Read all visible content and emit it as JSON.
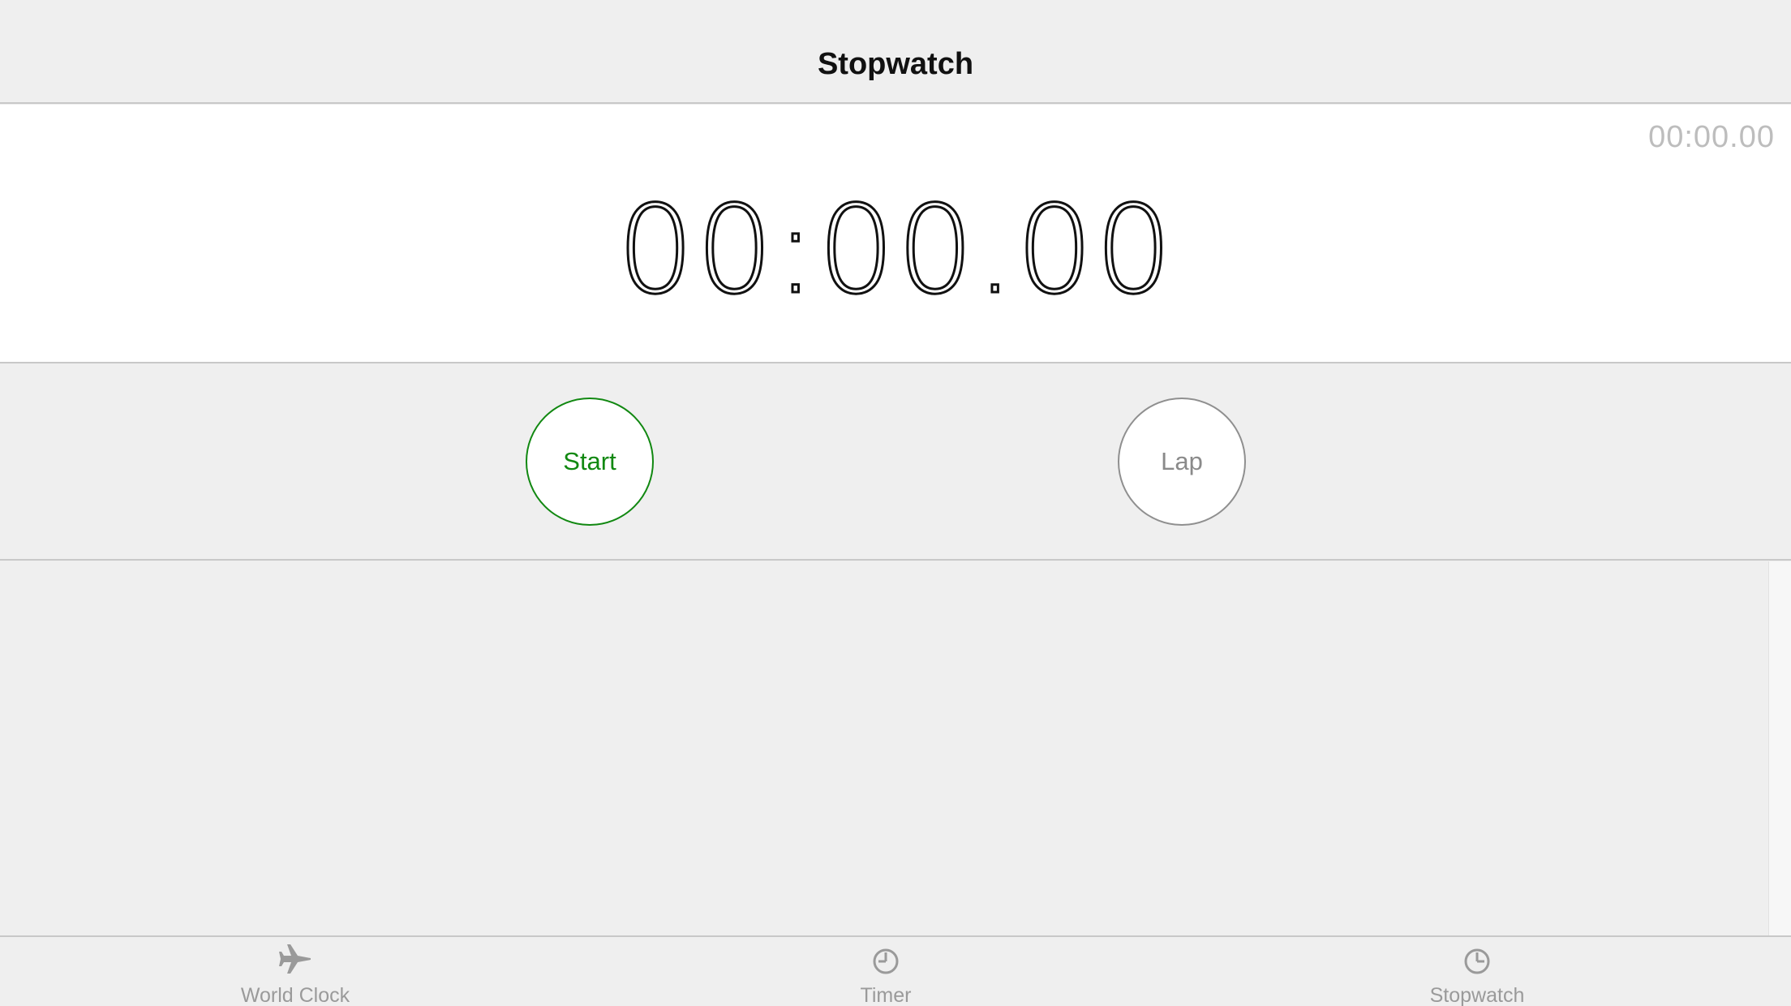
{
  "nav": {
    "title": "Stopwatch"
  },
  "timer": {
    "lap_time": "00:00.00",
    "main_time": "00:00.00"
  },
  "controls": {
    "start_label": "Start",
    "lap_label": "Lap"
  },
  "tabs": [
    {
      "label": "World Clock",
      "icon": "airplane-icon"
    },
    {
      "label": "Timer",
      "icon": "clock-icon"
    },
    {
      "label": "Stopwatch",
      "icon": "stopwatch-icon"
    }
  ],
  "colors": {
    "start_green": "#118811",
    "lap_gray": "#8f8f8f",
    "tab_gray": "#9a9a9a",
    "background": "#efefef"
  }
}
